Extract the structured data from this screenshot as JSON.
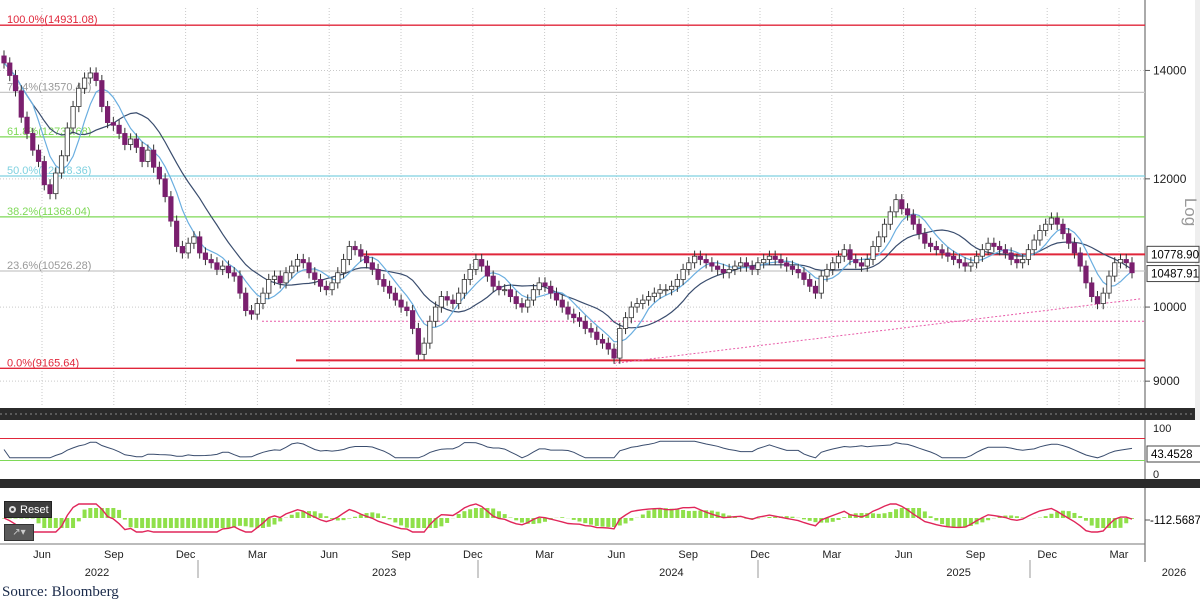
{
  "source": "Source: Bloomberg",
  "reset_label": "Reset",
  "scale_label": "Log",
  "colors": {
    "candle": "#7a1f6e",
    "ma_fast": "#6aaee0",
    "ma_slow": "#3a4d6e",
    "resistance": "#e0263a",
    "fib_red": "#e0263a",
    "fib_green": "#7ed957",
    "fib_cyan": "#7fd1e0",
    "fib_grey": "#c8c8c8",
    "trend": "#e85aa8",
    "rsi": "#3a4d6e",
    "macd_line": "#e0265a",
    "macd_hist": "#8fe04a"
  },
  "chart_data": {
    "type": "candlestick",
    "scale": "log",
    "y_ticks": [
      9000,
      10000,
      12000,
      14000
    ],
    "x_ticks": [
      {
        "month": "Jun",
        "year": "2022"
      },
      {
        "month": "Sep",
        "year": ""
      },
      {
        "month": "Dec",
        "year": ""
      },
      {
        "month": "Mar",
        "year": ""
      },
      {
        "month": "Jun",
        "year": "2023"
      },
      {
        "month": "Sep",
        "year": ""
      },
      {
        "month": "Dec",
        "year": ""
      },
      {
        "month": "Mar",
        "year": ""
      },
      {
        "month": "Jun",
        "year": "2024"
      },
      {
        "month": "Sep",
        "year": ""
      },
      {
        "month": "Dec",
        "year": ""
      },
      {
        "month": "Mar",
        "year": ""
      },
      {
        "month": "Jun",
        "year": "2025"
      },
      {
        "month": "Sep",
        "year": ""
      },
      {
        "month": "Dec",
        "year": ""
      },
      {
        "month": "Mar",
        "year": "2026"
      }
    ],
    "fib_levels": [
      {
        "label": "100.0%(14931.08)",
        "value": 14931.08,
        "color": "red"
      },
      {
        "label": "76.4%(13570.44)",
        "value": 13570.44,
        "color": "grey"
      },
      {
        "label": "61.8%(12738.68)",
        "value": 12738.68,
        "color": "green"
      },
      {
        "label": "50.0%(12048.36)",
        "value": 12048.36,
        "color": "cyan"
      },
      {
        "label": "38.2%(11368.04)",
        "value": 11368.04,
        "color": "green"
      },
      {
        "label": "23.6%(10526.28)",
        "value": 10526.28,
        "color": "grey"
      },
      {
        "label": "0.0%(9165.64)",
        "value": 9165.64,
        "color": "red"
      }
    ],
    "price_labels": [
      {
        "label": "10778.90",
        "value": 10778.9
      },
      {
        "label": "10487.91",
        "value": 10487.91
      }
    ],
    "horizontal_lines": [
      10778.9,
      9270
    ],
    "support_dotted": 9800,
    "trendline": {
      "from": {
        "date_index": 106,
        "value": 9230
      },
      "to": {
        "date_index": 205,
        "value": 10120
      }
    },
    "closes": [
      14150,
      13900,
      13600,
      13100,
      12800,
      12500,
      12300,
      11900,
      11750,
      12100,
      12400,
      12900,
      13300,
      13650,
      13850,
      13950,
      13800,
      13300,
      13000,
      12950,
      12800,
      12600,
      12700,
      12550,
      12300,
      12500,
      12200,
      12000,
      11700,
      11300,
      10900,
      10800,
      10950,
      11050,
      10800,
      10700,
      10650,
      10550,
      10600,
      10500,
      10450,
      10200,
      9950,
      9900,
      10050,
      10200,
      10400,
      10450,
      10350,
      10500,
      10600,
      10700,
      10650,
      10500,
      10400,
      10300,
      10250,
      10350,
      10500,
      10700,
      10900,
      10850,
      10750,
      10650,
      10550,
      10400,
      10300,
      10200,
      10100,
      10000,
      9950,
      9700,
      9350,
      9500,
      9800,
      10000,
      10150,
      10100,
      10050,
      10200,
      10400,
      10550,
      10700,
      10600,
      10450,
      10300,
      10250,
      10250,
      10150,
      10050,
      10000,
      10100,
      10250,
      10350,
      10300,
      10200,
      10100,
      10000,
      9900,
      9850,
      9800,
      9700,
      9650,
      9550,
      9500,
      9420,
      9300,
      9700,
      9850,
      10000,
      10050,
      10100,
      10150,
      10200,
      10250,
      10250,
      10300,
      10400,
      10550,
      10650,
      10750,
      10700,
      10650,
      10600,
      10550,
      10500,
      10550,
      10600,
      10650,
      10600,
      10550,
      10650,
      10700,
      10750,
      10700,
      10650,
      10600,
      10550,
      10500,
      10400,
      10300,
      10200,
      10450,
      10550,
      10650,
      10750,
      10850,
      10700,
      10650,
      10600,
      10700,
      10900,
      11050,
      11250,
      11450,
      11650,
      11500,
      11400,
      11250,
      11100,
      10950,
      10900,
      10850,
      10800,
      10750,
      10700,
      10650,
      10600,
      10650,
      10750,
      10850,
      10950,
      10900,
      10850,
      10800,
      10700,
      10650,
      10700,
      10850,
      11000,
      11150,
      11250,
      11350,
      11250,
      11100,
      10950,
      10800,
      10600,
      10350,
      10150,
      10050,
      10200,
      10450,
      10650,
      10700,
      10650,
      10500
    ]
  },
  "rsi": {
    "value_label": "43.4528",
    "ticks": [
      "100",
      "50",
      "0"
    ]
  },
  "macd": {
    "value_label": "-112.5687"
  }
}
